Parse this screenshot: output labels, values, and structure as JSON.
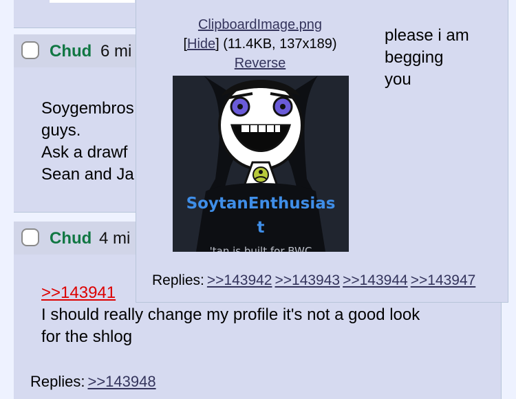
{
  "posts": [
    {
      "name": "Chud",
      "time": "6 mi",
      "lines": [
        "Soygembros",
        "guys.",
        "Ask a drawf",
        "Sean and Ja"
      ]
    },
    {
      "name": "Chud",
      "time": "4 mi",
      "quote": ">>143941",
      "lines": [
        "I should really change my profile it's not a good look",
        "for the shlog"
      ],
      "replies_label": "Replies:",
      "replies": [
        ">>143948"
      ]
    }
  ],
  "popup": {
    "file_name": "ClipboardImage.png",
    "hide_bracket_open": "[",
    "hide_label": "Hide",
    "hide_bracket_close": "]",
    "file_meta": " (11.4KB, 137x189)",
    "reverse_label": "Reverse",
    "message_lines": [
      "please i am",
      "begging",
      "you"
    ],
    "replies_label": "Replies:",
    "replies": [
      ">>143942",
      ">>143943",
      ">>143944",
      ">>143947"
    ],
    "thumbnail": {
      "caption_line1": "SoytanEnthusias",
      "caption_line2": "t",
      "caption_line3": "'tan is built for BWC",
      "colors": {
        "background": "#20252f",
        "face": "#ffffff",
        "eye": "#6a5bd8",
        "badge": "#b7c93a",
        "caption": "#3f8ee8"
      }
    }
  },
  "colors": {
    "page_bg": "#eef2ff",
    "post_bg": "#d6daf0",
    "name": "#117743",
    "quote": "#dd0000",
    "link": "#34345c"
  }
}
